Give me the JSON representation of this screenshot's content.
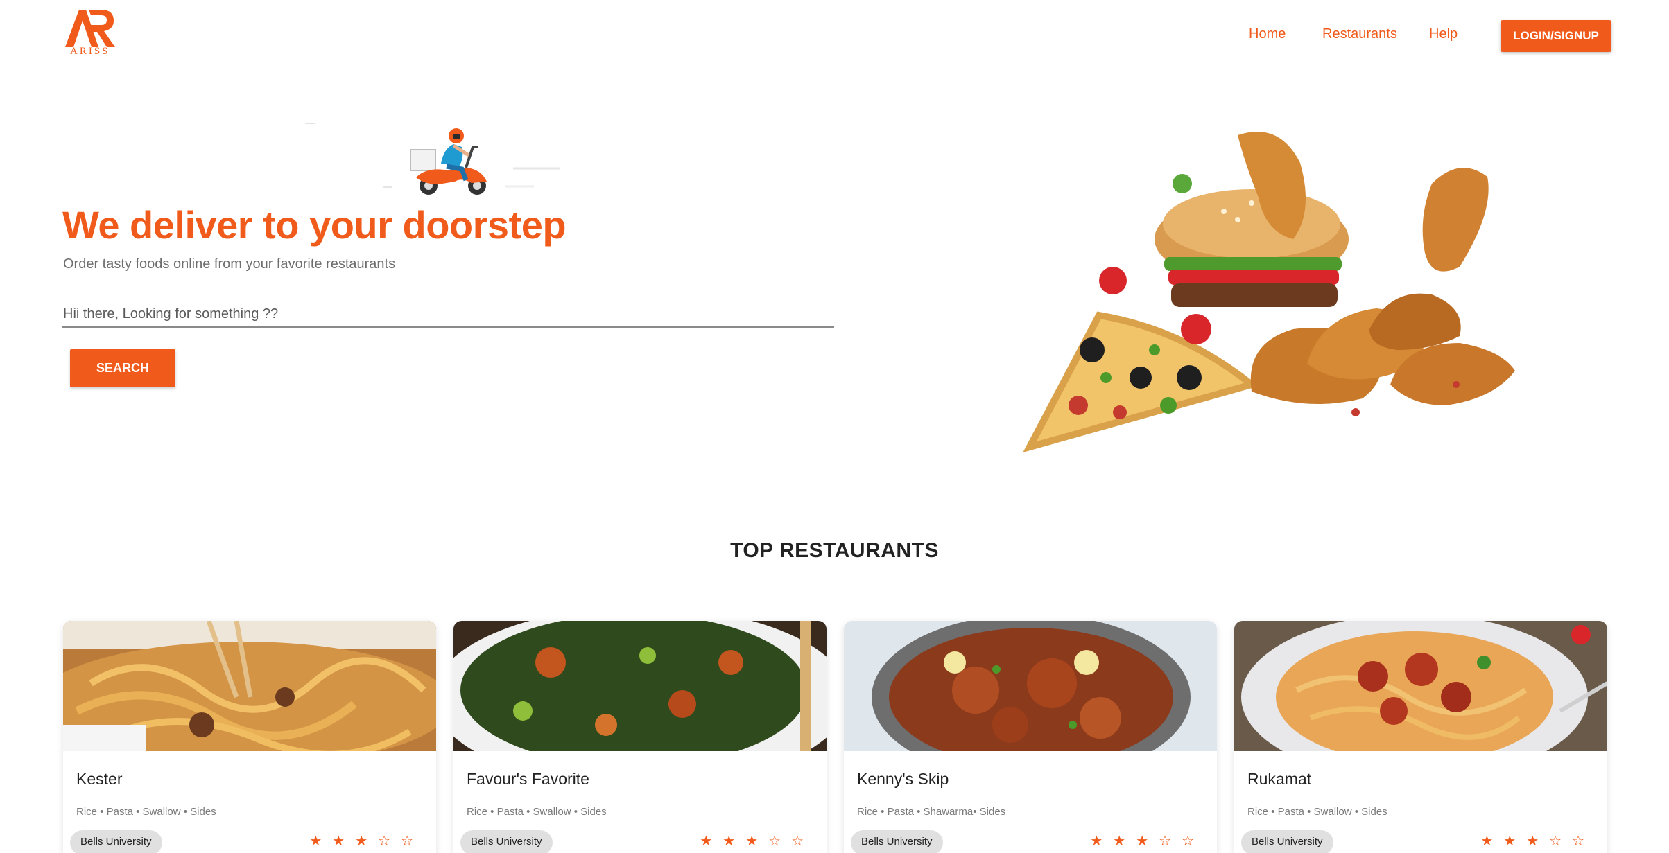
{
  "brand": {
    "logo_text": "ARISS",
    "accent_color": "#f05a1a"
  },
  "nav": {
    "home": "Home",
    "restaurants": "Restaurants",
    "help": "Help",
    "login": "LOGIN/SIGNUP"
  },
  "hero": {
    "title": "We deliver to your doorstep",
    "subtitle": "Order tasty foods online from your favorite restaurants",
    "search_placeholder": "Hii there, Looking for something ??",
    "search_button": "SEARCH"
  },
  "section_title": "TOP RESTAURANTS",
  "restaurants": [
    {
      "name": "Kester",
      "tags": "Rice • Pasta • Swallow • Sides",
      "location": "Bells University",
      "rating": 3,
      "stars_text": "★★★☆☆"
    },
    {
      "name": "Favour's Favorite",
      "tags": "Rice • Pasta • Swallow • Sides",
      "location": "Bells University",
      "rating": 3,
      "stars_text": "★★★☆☆"
    },
    {
      "name": "Kenny's Skip",
      "tags": "Rice • Pasta • Shawarma• Sides",
      "location": "Bells University",
      "rating": 3,
      "stars_text": "★★★☆☆"
    },
    {
      "name": "Rukamat",
      "tags": "Rice • Pasta • Swallow • Sides",
      "location": "Bells University",
      "rating": 3,
      "stars_text": "★★★☆☆"
    }
  ]
}
